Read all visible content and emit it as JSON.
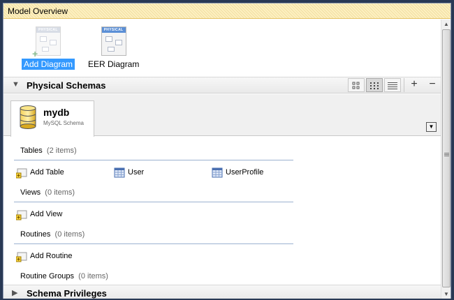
{
  "window": {
    "title": "Model Overview"
  },
  "diagrams": {
    "add": {
      "label": "Add Diagram",
      "thumb_caption": "PHYSICAL"
    },
    "eer": {
      "label": "EER Diagram",
      "thumb_caption": "PHYSICAL"
    }
  },
  "physical_schemas": {
    "title": "Physical Schemas",
    "view_buttons": [
      "large-icons",
      "small-icons",
      "list"
    ],
    "add_symbol": "+",
    "remove_symbol": "−"
  },
  "schema": {
    "name": "mydb",
    "subtitle": "MySQL Schema"
  },
  "groups": {
    "tables": {
      "label": "Tables",
      "count": "(2 items)",
      "add": "Add Table",
      "items": [
        "User",
        "UserProfile"
      ]
    },
    "views": {
      "label": "Views",
      "count": "(0 items)",
      "add": "Add View"
    },
    "routines": {
      "label": "Routines",
      "count": "(0 items)",
      "add": "Add Routine"
    },
    "routine_groups": {
      "label": "Routine Groups",
      "count": "(0 items)"
    }
  },
  "schema_privileges": {
    "title": "Schema Privileges"
  },
  "colors": {
    "selection": "#3399ff",
    "title_bar": "#fdf0c0",
    "group_line": "#9cb2d0"
  }
}
